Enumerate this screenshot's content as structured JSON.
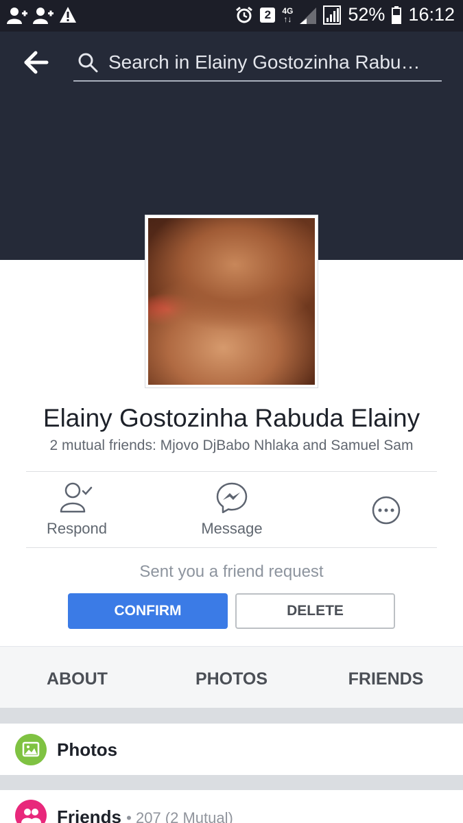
{
  "status_bar": {
    "battery_percent": "52%",
    "time": "16:12",
    "sim_slot": "2",
    "network": "4G",
    "icons": [
      "person-add-icon",
      "person-add-icon",
      "warning-icon",
      "alarm-icon",
      "sim-2-icon",
      "network-4g-icon",
      "signal-icon",
      "signal-icon",
      "battery-icon"
    ]
  },
  "header": {
    "search_placeholder": "Search in Elainy Gostozinha Rabu…"
  },
  "profile": {
    "name": "Elainy Gostozinha Rabuda Elainy",
    "mutual_friends": "2 mutual friends: Mjovo DjBabo Nhlaka and Samuel Sam"
  },
  "actions": {
    "respond": "Respond",
    "message": "Message"
  },
  "friend_request": {
    "text": "Sent you a friend request",
    "confirm_label": "CONFIRM",
    "delete_label": "DELETE"
  },
  "tabs": [
    "ABOUT",
    "PHOTOS",
    "FRIENDS"
  ],
  "sections": {
    "photos": {
      "title": "Photos"
    },
    "friends": {
      "title": "Friends",
      "meta": "207 (2 Mutual)"
    }
  },
  "colors": {
    "accent": "#3b7be6",
    "header_bg": "#252a38",
    "photos_icon": "#7fc242",
    "friends_icon": "#e8287b"
  }
}
